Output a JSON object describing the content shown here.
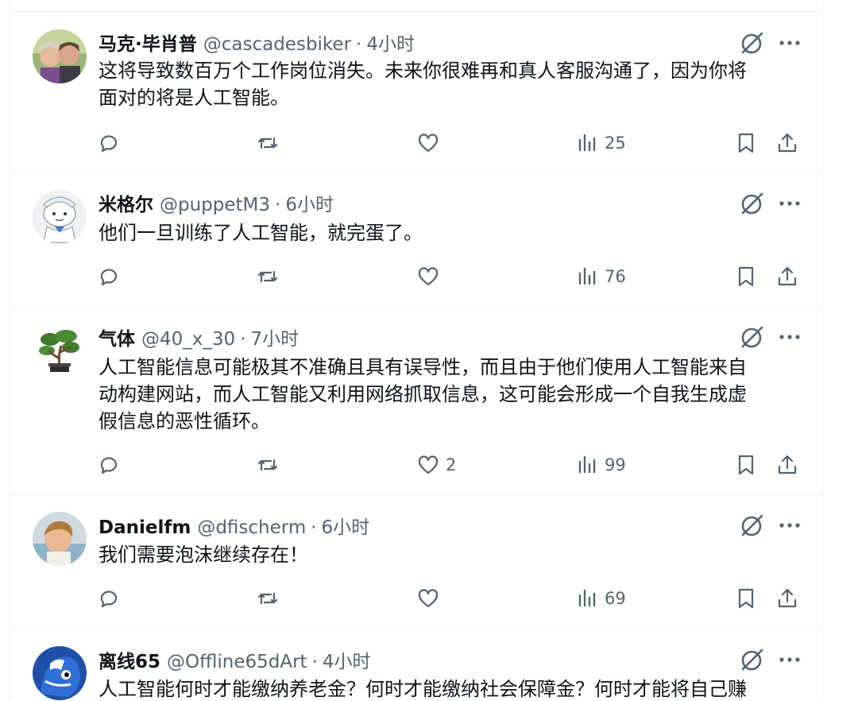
{
  "tweets": [
    {
      "name": "马克·毕肖普",
      "handle": "@cascadesbiker",
      "separator": "·",
      "time": "4小时",
      "lines": [
        "这将导致数百万个工作岗位消失。未来你很难再和真人客服沟通了，因为你将",
        "面对的将是人工智能。"
      ],
      "reply_count": "",
      "retweet_count": "",
      "like_count": "",
      "views": "25",
      "avatar": "photo-couple"
    },
    {
      "name": "米格尔",
      "handle": "@puppetM3",
      "separator": "·",
      "time": "6小时",
      "lines": [
        "他们一旦训练了人工智能，就完蛋了。"
      ],
      "reply_count": "",
      "retweet_count": "",
      "like_count": "",
      "views": "76",
      "avatar": "cartoon-character"
    },
    {
      "name": "气体",
      "handle": "@40_x_30",
      "separator": "·",
      "time": "7小时",
      "lines": [
        "人工智能信息可能极其不准确且具有误导性，而且由于他们使用人工智能来自",
        "动构建网站，而人工智能又利用网络抓取信息，这可能会形成一个自我生成虚",
        "假信息的恶性循环。"
      ],
      "reply_count": "",
      "retweet_count": "",
      "like_count": "2",
      "views": "99",
      "avatar": "bonsai-tree"
    },
    {
      "name": "Danielfm",
      "handle": "@dfischerm",
      "separator": "·",
      "time": "6小时",
      "lines": [
        "我们需要泡沫继续存在！"
      ],
      "reply_count": "",
      "retweet_count": "",
      "like_count": "",
      "views": "69",
      "avatar": "photo-child"
    },
    {
      "name": "离线65",
      "handle": "@Offline65dArt",
      "separator": "·",
      "time": "4小时",
      "lines": [
        "人工智能何时才能缴纳养老金？何时才能缴纳社会保障金？何时才能将自己赚"
      ],
      "reply_count": "",
      "retweet_count": "",
      "like_count": "",
      "views": "",
      "avatar": "blue-mascot"
    }
  ],
  "icons": {
    "reply": "reply-icon",
    "retweet": "retweet-icon",
    "like": "like-icon",
    "views": "views-icon",
    "bookmark": "bookmark-icon",
    "share": "share-icon",
    "grok": "grok-icon",
    "more": "more-icon"
  },
  "colors": {
    "text": "#0f1419",
    "secondary": "#536471",
    "border": "#eff3f4"
  }
}
